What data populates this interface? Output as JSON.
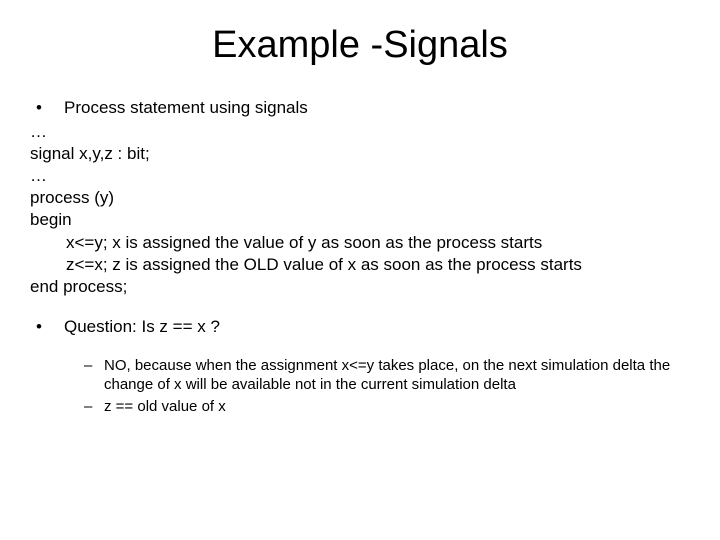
{
  "title": "Example -Signals",
  "b1": "Process statement using signals",
  "code": {
    "l1": "…",
    "l2": "signal x,y,z : bit;",
    "l3": "…",
    "l4": "process (y)",
    "l5": "begin",
    "l6": "x<=y; x is assigned the value of y as soon as the process starts",
    "l7": "z<=x; z is assigned the OLD value of x as soon as the process starts",
    "l8": "end process;"
  },
  "q": "Question: Is z == x ?",
  "a1": "NO, because when the assignment x<=y takes place, on the next simulation delta the change of x will be available not in the current simulation delta",
  "a2": "z == old value of x"
}
